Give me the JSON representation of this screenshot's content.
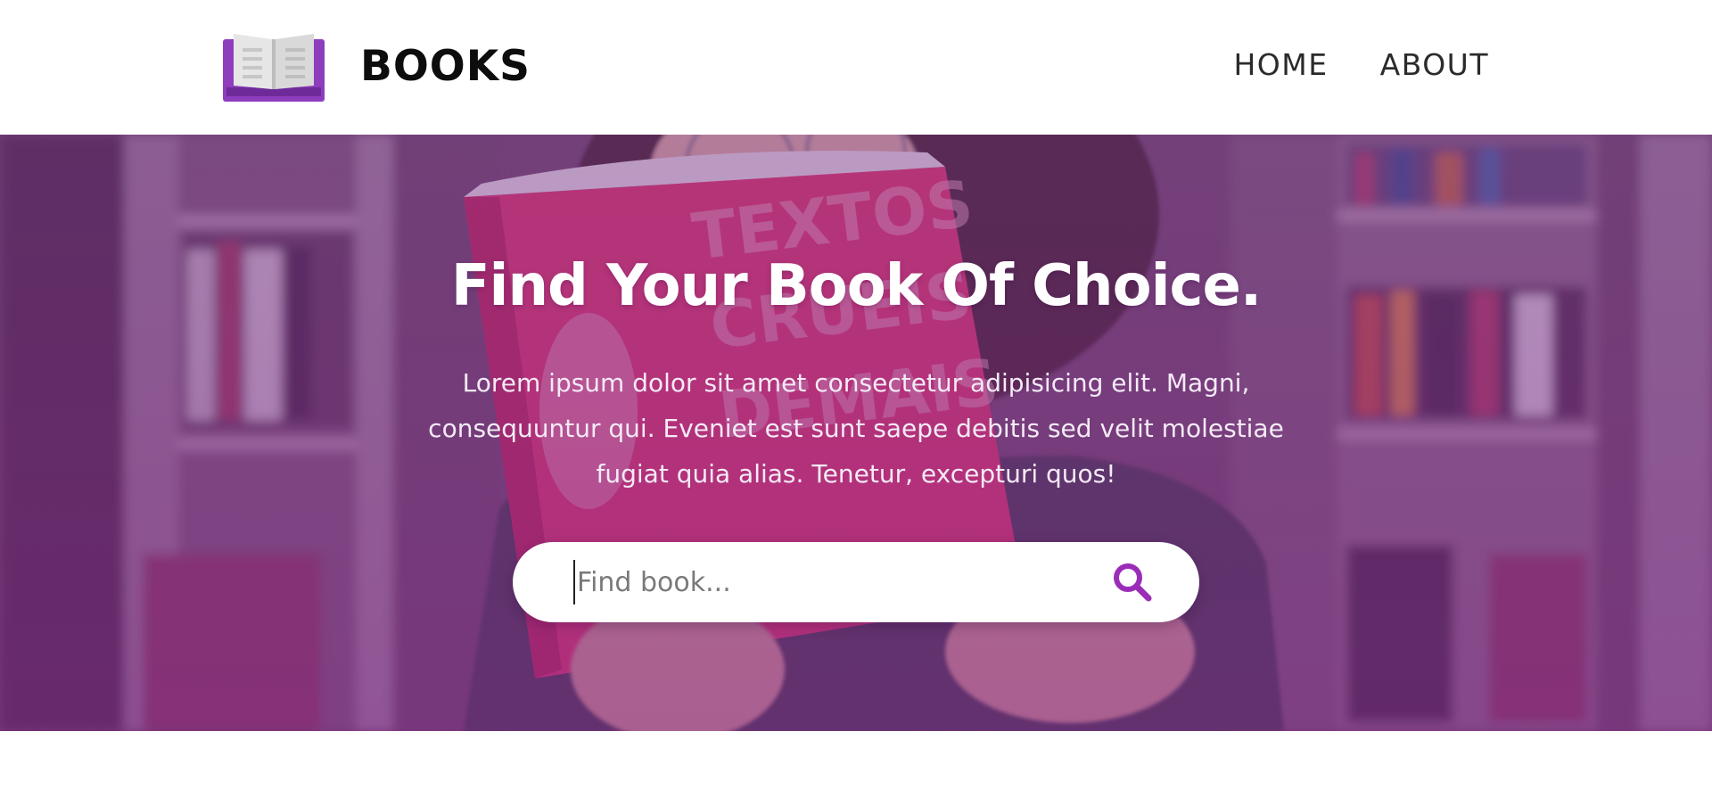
{
  "navbar": {
    "brand_name": "BOOKS",
    "logo_icon": "open-book-icon",
    "links": [
      {
        "label": "HOME"
      },
      {
        "label": "ABOUT"
      }
    ]
  },
  "hero": {
    "background": "photo-woman-reading-red-book-in-library",
    "title": "Find Your Book Of Choice.",
    "description": "Lorem ipsum dolor sit amet consectetur adipisicing elit. Magni, consequuntur qui. Eveniet est sunt saepe debitis sed velit molestiae fugiat quia alias. Tenetur, excepturi quos!",
    "search": {
      "placeholder": "Find book...",
      "value": "",
      "icon": "search-icon"
    }
  },
  "colors": {
    "accent": "#9b2cb8",
    "logo_purple": "#8e3dbd",
    "hero_overlay": "#7a348c",
    "text_dark": "#0d0d0d"
  }
}
